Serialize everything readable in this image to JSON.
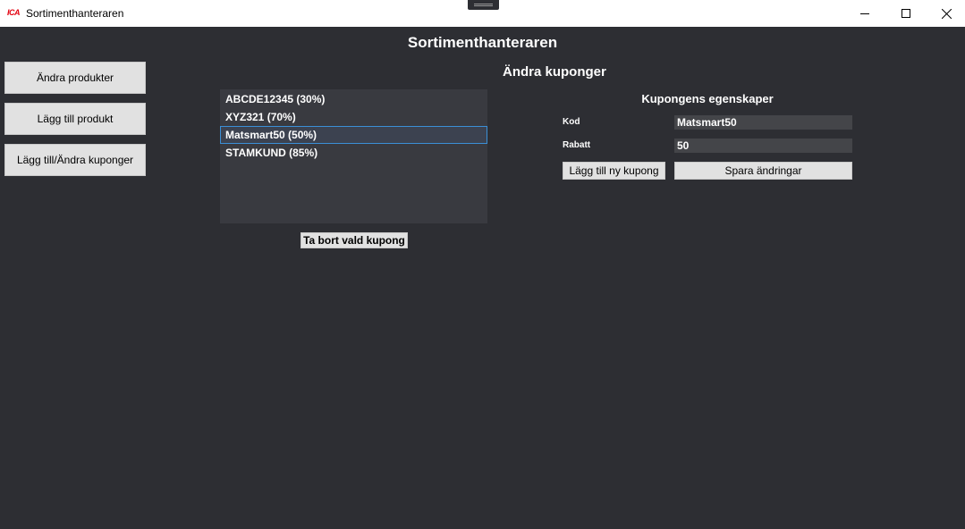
{
  "window": {
    "logo_text": "ICA",
    "title": "Sortimenthanteraren"
  },
  "header": {
    "title": "Sortimenthanteraren",
    "section_title": "Ändra kuponger"
  },
  "sidebar": {
    "items": [
      {
        "label": "Ändra produkter"
      },
      {
        "label": "Lägg till produkt"
      },
      {
        "label": "Lägg till/Ändra kuponger"
      }
    ]
  },
  "coupons": {
    "items": [
      {
        "label": "ABCDE12345 (30%)"
      },
      {
        "label": "XYZ321 (70%)"
      },
      {
        "label": "Matsmart50 (50%)"
      },
      {
        "label": "STAMKUND (85%)"
      }
    ],
    "selected_index": 2,
    "remove_label": "Ta bort vald kupong"
  },
  "properties": {
    "title": "Kupongens egenskaper",
    "code_label": "Kod",
    "code_value": "Matsmart50",
    "discount_label": "Rabatt",
    "discount_value": "50",
    "add_label": "Lägg till ny kupong",
    "save_label": "Spara ändringar"
  },
  "colors": {
    "background": "#2d2e33",
    "list_background": "#393a40",
    "selection_border": "#3b8fd6",
    "brand": "#e3000f"
  }
}
